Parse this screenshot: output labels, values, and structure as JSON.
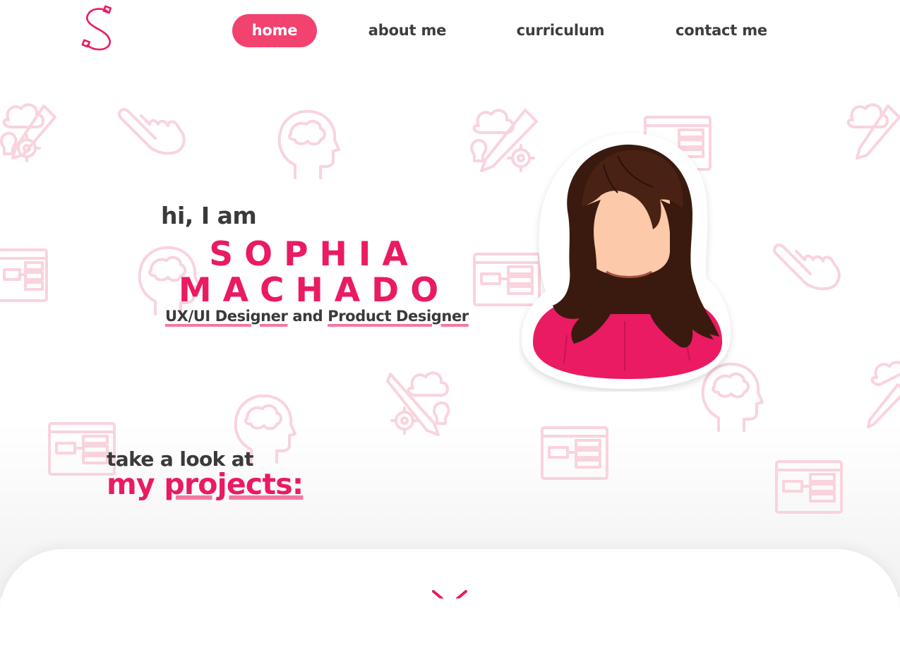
{
  "app": {
    "logo_icon": "script-s-logo-icon",
    "accent_color": "#ea1a63",
    "nav_active_color": "#f2426f"
  },
  "nav": {
    "items": [
      {
        "label": "home",
        "active": true
      },
      {
        "label": "about me",
        "active": false
      },
      {
        "label": "curriculum",
        "active": false
      },
      {
        "label": "contact me",
        "active": false
      }
    ]
  },
  "hero": {
    "greeting": "hi, I am",
    "first_name": "SOPHIA",
    "last_name": "MACHADO",
    "role_1": "UX/UI Designer",
    "role_join": " and ",
    "role_2": "Product Designer",
    "avatar_icon": "woman-avatar-illustration"
  },
  "projects": {
    "pre": "take a look at",
    "title_my": "my ",
    "title_projects": "projects:"
  },
  "background_icons": [
    "pointer-hand-icon",
    "brain-head-icon",
    "idea-gear-pencil-icon",
    "wireframe-window-icon"
  ]
}
